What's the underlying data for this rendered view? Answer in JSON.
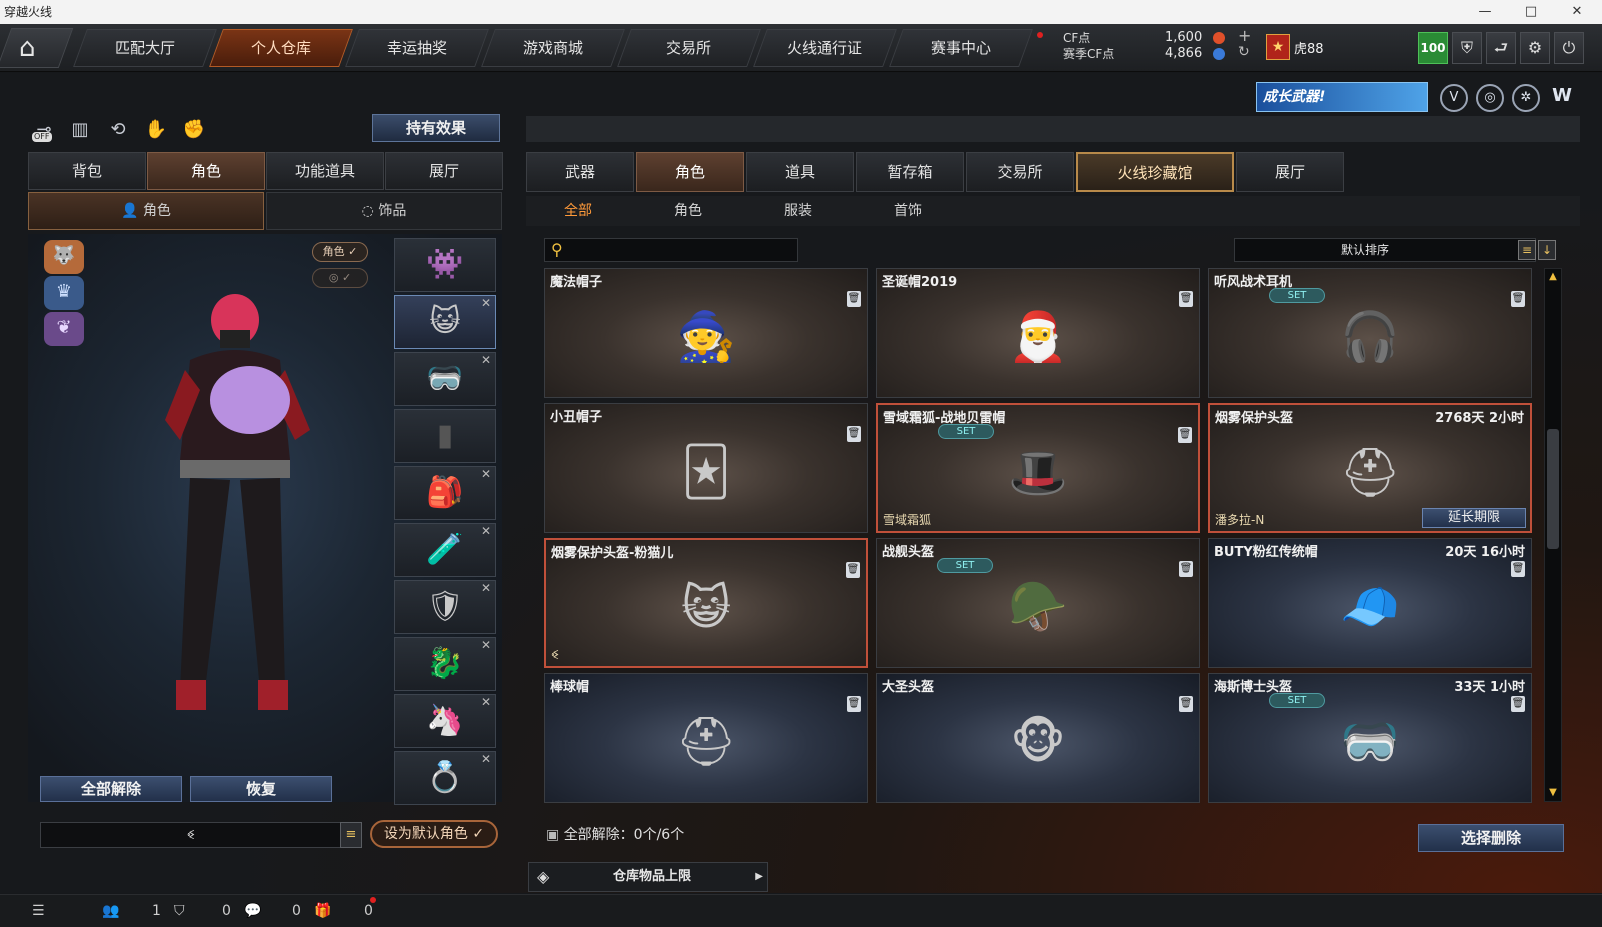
{
  "window": {
    "title": "穿越火线",
    "controls": [
      "—",
      "□",
      "✕"
    ]
  },
  "nav": {
    "home_icon": "home-icon",
    "items": [
      "匹配大厅",
      "个人仓库",
      "幸运抽奖",
      "游戏商城",
      "交易所",
      "火线通行证",
      "赛事中心"
    ],
    "active": "个人仓库"
  },
  "currency": {
    "cf_label": "CF点",
    "cf_value": "1,600",
    "season_label": "赛季CF点",
    "season_value": "4,866"
  },
  "player": {
    "rank_name": "虎88",
    "level": "100"
  },
  "banner": {
    "text": "成长武器!"
  },
  "left": {
    "hold_effect_button": "持有效果",
    "toggle_off": "OFF",
    "tabs": [
      "背包",
      "角色",
      "功能道具",
      "展厅"
    ],
    "active_tab": "角色",
    "subtabs": [
      "角色",
      "饰品"
    ],
    "pill_role": "角色 ✓",
    "pill_hidden": "◎ ✓",
    "release_all": "全部解除",
    "restore": "恢复",
    "char_name": "ꔽ",
    "set_default": "设为默认角色 ✓"
  },
  "right": {
    "tabs": [
      "武器",
      "角色",
      "道具",
      "暂存箱",
      "交易所",
      "火线珍藏馆",
      "展厅"
    ],
    "active_tab": "角色",
    "subtabs": [
      "全部",
      "角色",
      "服装",
      "首饰"
    ],
    "active_subtab": "全部",
    "search_placeholder": "",
    "sort_label": "默认排序",
    "items": [
      {
        "name": "魔法帽子",
        "time": "",
        "set": false,
        "tag": "",
        "icon": "wizard-hat-icon",
        "glyph": "🧙"
      },
      {
        "name": "圣诞帽2019",
        "time": "",
        "set": false,
        "tag": "",
        "icon": "santa-hat-icon",
        "glyph": "🎅"
      },
      {
        "name": "听风战术耳机",
        "time": "",
        "set": true,
        "tag": "",
        "icon": "headphones-icon",
        "glyph": "🎧"
      },
      {
        "name": "小丑帽子",
        "time": "",
        "set": false,
        "tag": "",
        "icon": "jester-hat-icon",
        "glyph": "🃏"
      },
      {
        "name": "雪域霜狐-战地贝雷帽",
        "time": "",
        "set": true,
        "tag": "雪域霜狐",
        "icon": "beret-icon",
        "glyph": "🎩"
      },
      {
        "name": "烟雾保护头盔",
        "time": "2768天 2小时",
        "set": false,
        "tag": "潘多拉-N",
        "icon": "gas-mask-helmet-icon",
        "glyph": "⛑"
      },
      {
        "name": "烟雾保护头盔-粉猫儿",
        "time": "",
        "set": false,
        "tag": "ꔽ",
        "icon": "pink-cat-helmet-icon",
        "glyph": "😺"
      },
      {
        "name": "战舰头盔",
        "time": "",
        "set": true,
        "tag": "",
        "icon": "battleship-helmet-icon",
        "glyph": "🪖"
      },
      {
        "name": "BUTY粉红传统帽",
        "time": "20天 16小时",
        "set": false,
        "tag": "",
        "icon": "pink-cap-icon",
        "glyph": "🧢"
      },
      {
        "name": "棒球帽",
        "time": "",
        "set": false,
        "tag": "",
        "icon": "baseball-helmet-icon",
        "glyph": "⛑"
      },
      {
        "name": "大圣头盔",
        "time": "",
        "set": false,
        "tag": "",
        "icon": "monkey-king-helmet-icon",
        "glyph": "🐵"
      },
      {
        "name": "海斯博士头盔",
        "time": "33天 1小时",
        "set": true,
        "tag": "",
        "icon": "dr-heist-helmet-icon",
        "glyph": "🥽"
      }
    ],
    "set_badge": "SET",
    "extend_label": "延长期限",
    "release_status": "全部解除：0个/6个",
    "select_delete": "选择删除",
    "capacity": "仓库物品上限"
  },
  "status": {
    "counts": [
      "1",
      "0",
      "0",
      "0"
    ]
  },
  "colors": {
    "accent": "#ff9a3a",
    "active_nav": "#7a3415",
    "level_green": "#2a8b35",
    "selected_border": "#c0503a"
  }
}
